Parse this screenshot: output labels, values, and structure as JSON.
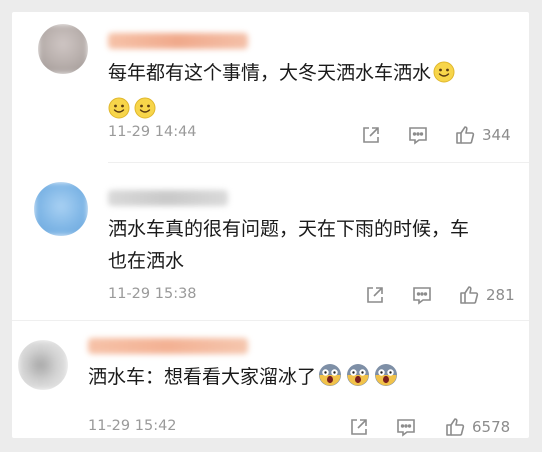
{
  "comments": [
    {
      "text_lines": [
        "每年都有这个事情，大冬天洒水车洒水"
      ],
      "emojis_line1": [
        "smile-emoji"
      ],
      "emojis_line2": [
        "smile-emoji",
        "smile-emoji"
      ],
      "timestamp": "11-29 14:44",
      "like_count": "344"
    },
    {
      "text_lines": [
        "洒水车真的很有问题，天在下雨的时候，车",
        "也在洒水"
      ],
      "timestamp": "11-29 15:38",
      "like_count": "281"
    },
    {
      "text_lines": [
        "洒水车：想看看大家溜冰了"
      ],
      "emojis_line1": [
        "scared-emoji",
        "scared-emoji",
        "scared-emoji"
      ],
      "timestamp": "11-29 15:42",
      "like_count": "6578"
    }
  ],
  "colors": {
    "text": "#1a1a1a",
    "meta": "#9a9a9a",
    "icon": "#8c8c8c",
    "username_orange": "#f2b59a",
    "avatar_blue": "#7fb6e6"
  }
}
